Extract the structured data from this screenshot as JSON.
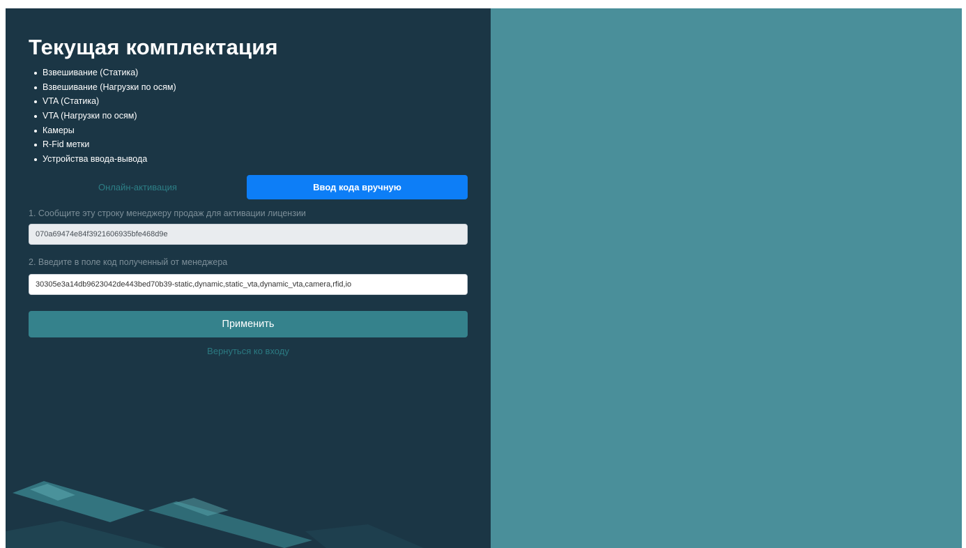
{
  "license": {
    "title": "Текущая комплектация",
    "features": [
      "Взвешивание (Статика)",
      "Взвешивание (Нагрузки по осям)",
      "VTA (Статика)",
      "VTA (Нагрузки по осям)",
      "Камеры",
      "R-Fid метки",
      "Устройства ввода-вывода"
    ]
  },
  "tabs": {
    "online_label": "Онлайн-активация",
    "manual_label": "Ввод кода вручную",
    "active": "manual"
  },
  "form": {
    "step1_label": "1. Сообщите эту строку менеджеру продаж для активации лицензии",
    "request_string": "070a69474e84f3921606935bfe468d9e",
    "step2_label": "2. Введите в поле код полученный от менеджера",
    "activation_code": "30305e3a14db9623042de443bed70b39-static,dynamic,static_vta,dynamic_vta,camera,rfid,io",
    "apply_label": "Применить",
    "back_label": "Вернуться ко входу"
  },
  "colors": {
    "left_panel_bg": "#1b3645",
    "right_panel_bg": "#4a8f9a",
    "active_tab": "#0d7ef7",
    "apply_button": "#35828c",
    "link": "#2b7a82"
  }
}
